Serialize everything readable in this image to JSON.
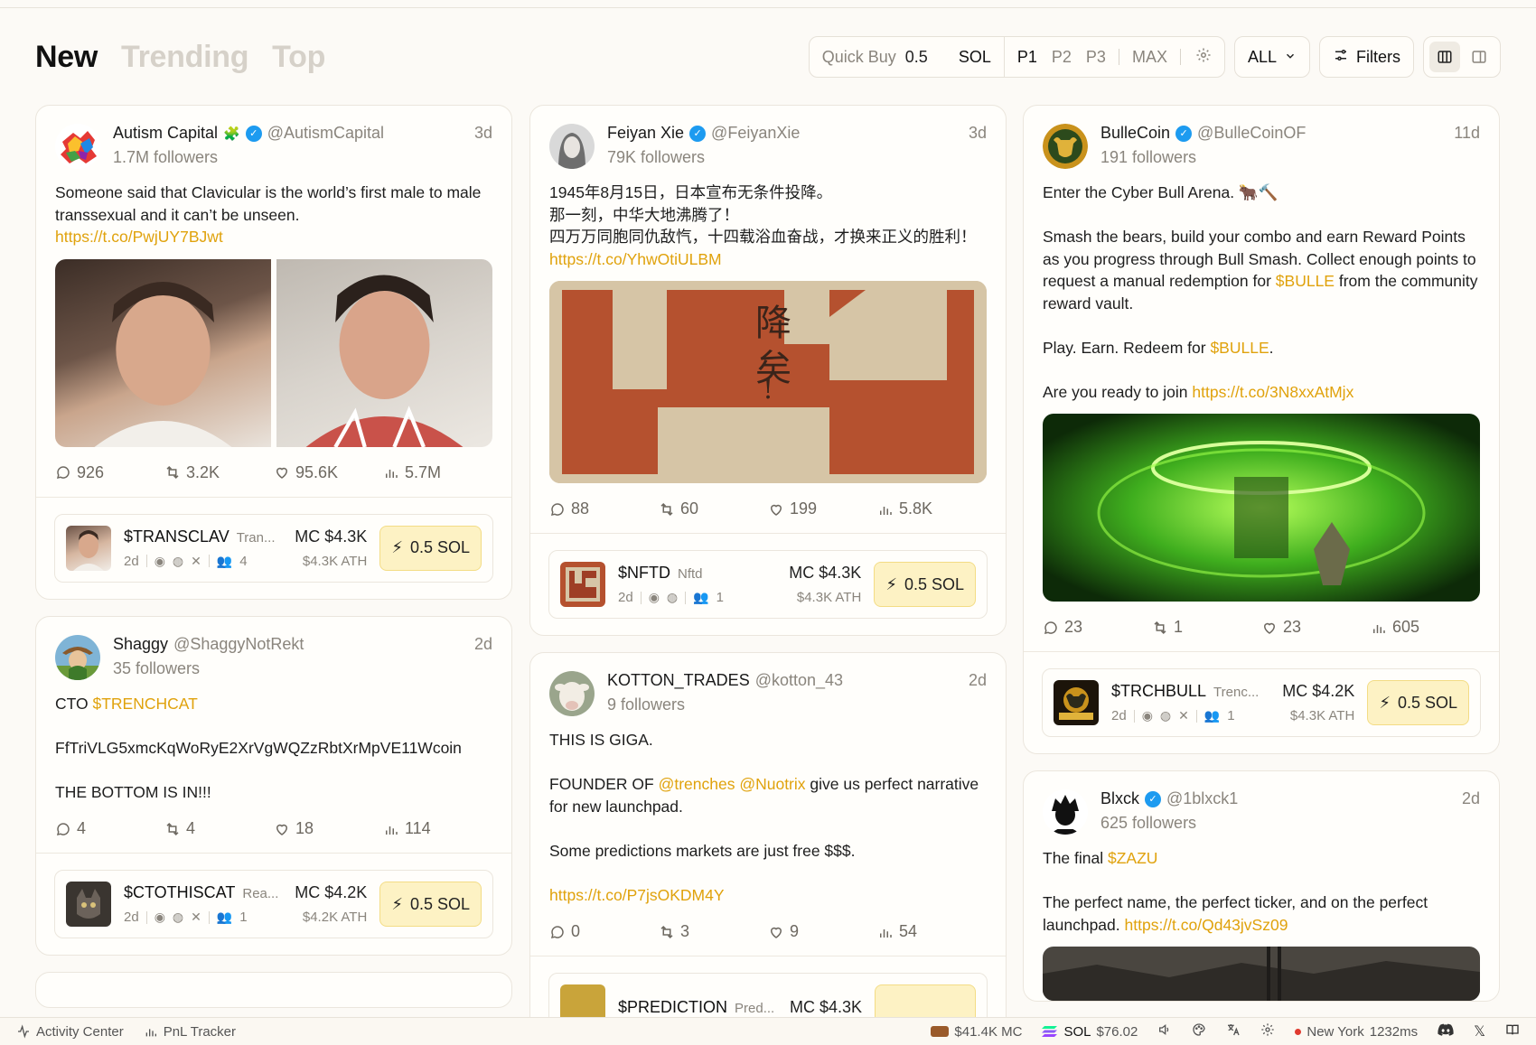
{
  "tabs": [
    "New",
    "Trending",
    "Top"
  ],
  "quick_buy": {
    "label": "Quick Buy",
    "value": "0.5",
    "unit": "SOL",
    "presets": [
      "P1",
      "P2",
      "P3"
    ],
    "max": "MAX"
  },
  "all_select": "ALL",
  "filters_label": "Filters",
  "posts": [
    {
      "col": 0,
      "name": "Autism Capital",
      "emoji": "🧩",
      "verified": true,
      "handle": "@AutismCapital",
      "followers": "1.7M followers",
      "time": "3d",
      "text": "Someone said that Clavicular is the world’s first male to male transsexual and it can’t be unseen.",
      "link": "https://t.co/PwjUY7BJwt",
      "stats": {
        "replies": "926",
        "retweets": "3.2K",
        "likes": "95.6K",
        "views": "5.7M"
      },
      "token": {
        "symbol": "$TRANSCLAV",
        "name": "Tran...",
        "age": "2d",
        "holders": "4",
        "mc": "MC $4.3K",
        "ath": "$4.3K ATH",
        "buy": "0.5 SOL",
        "has_x": true
      }
    },
    {
      "col": 0,
      "name": "Shaggy",
      "verified": false,
      "handle": "@ShaggyNotRekt",
      "followers": "35 followers",
      "time": "2d",
      "text_pre": "CTO ",
      "cashtag": "$TRENCHCAT",
      "text_post": "FfTriVLG5xmcKqWoRyE2XrVgWQZzRbtXrMpVE11Wcoin\n\nTHE BOTTOM IS IN!!!",
      "stats": {
        "replies": "4",
        "retweets": "4",
        "likes": "18",
        "views": "114"
      },
      "token": {
        "symbol": "$CTOTHISCAT",
        "name": "Rea...",
        "age": "2d",
        "holders": "1",
        "mc": "MC $4.2K",
        "ath": "$4.2K ATH",
        "buy": "0.5 SOL",
        "has_x": true
      }
    },
    {
      "col": 1,
      "name": "Feiyan Xie",
      "verified": true,
      "handle": "@FeiyanXie",
      "followers": "79K followers",
      "time": "3d",
      "text": "1945年8月15日，日本宣布无条件投降。\n那一刻，中华大地沸腾了！\n四万万同胞同仇敌忾，十四载浴血奋战，才换来正义的胜利！",
      "link": "https://t.co/YhwOtiULBM",
      "stats": {
        "replies": "88",
        "retweets": "60",
        "likes": "199",
        "views": "5.8K"
      },
      "token": {
        "symbol": "$NFTD",
        "name": "Nftd",
        "age": "2d",
        "holders": "1",
        "mc": "MC $4.3K",
        "ath": "$4.3K ATH",
        "buy": "0.5 SOL",
        "has_x": false
      }
    },
    {
      "col": 1,
      "name": "KOTTON_TRADES",
      "verified": false,
      "handle": "@kotton_43",
      "followers": "9 followers",
      "time": "2d",
      "text_a": "THIS IS GIGA.\n\nFOUNDER OF ",
      "mention1": "@trenches",
      "mention2": "@Nuotrix",
      "text_b": "  give us perfect narrative for new launchpad.\n\nSome predictions markets are just free $$$.",
      "link": "https://t.co/P7jsOKDM4Y",
      "stats": {
        "replies": "0",
        "retweets": "3",
        "likes": "9",
        "views": "54"
      },
      "token": {
        "symbol": "$PREDICTION",
        "name": "Pred...",
        "mc": "MC $4.3K"
      }
    },
    {
      "col": 2,
      "name": "BulleCoin",
      "verified": true,
      "handle": "@BulleCoinOF",
      "followers": "191 followers",
      "time": "11d",
      "text_a": "Enter the Cyber Bull Arena. 🐂🔨\n\nSmash the bears, build your combo and earn Reward Points as you progress through Bull Smash. Collect enough points to request a manual redemption for ",
      "cashtag": "$BULLE",
      "text_b": " from the community reward vault.\n\nPlay. Earn. Redeem for ",
      "text_c": ".\n\nAre you ready to join ",
      "link": "https://t.co/3N8xxAtMjx",
      "stats": {
        "replies": "23",
        "retweets": "1",
        "likes": "23",
        "views": "605"
      },
      "token": {
        "symbol": "$TRCHBULL",
        "name": "Trenc...",
        "age": "2d",
        "holders": "1",
        "mc": "MC $4.2K",
        "ath": "$4.3K ATH",
        "buy": "0.5 SOL",
        "has_x": true
      }
    },
    {
      "col": 2,
      "name": "Blxck",
      "verified": true,
      "handle": "@1blxck1",
      "followers": "625 followers",
      "time": "2d",
      "text_pre": "The final ",
      "cashtag": "$ZAZU",
      "text_post": "\n\nThe perfect name, the perfect ticker, and on the perfect launchpad. ",
      "link": "https://t.co/Qd43jvSz09"
    }
  ],
  "bottom": {
    "activity": "Activity Center",
    "pnl": "PnL Tracker",
    "mc": "$41.4K MC",
    "sol_label": "SOL",
    "sol_price": "$76.02",
    "region": "New York",
    "latency": "1232ms"
  },
  "colors": {
    "accent": "#e0a20c",
    "buy_bg": "#fdf2c4",
    "verified": "#1d9bf0"
  }
}
